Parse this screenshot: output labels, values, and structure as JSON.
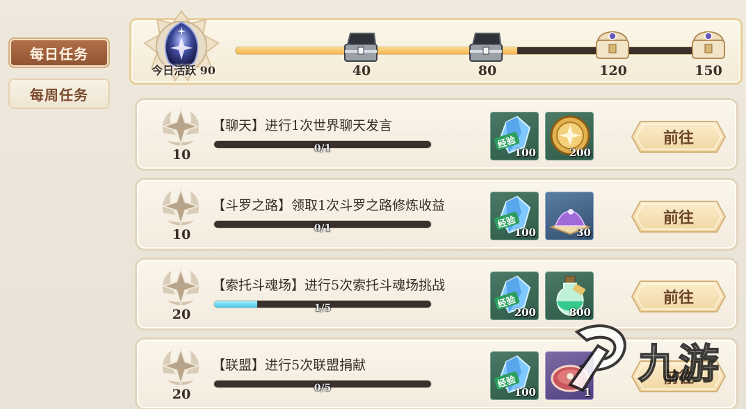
{
  "tabs": {
    "daily": "每日任务",
    "weekly": "每周任务"
  },
  "activity": {
    "label": "今日活跃 90",
    "progress_fraction": 0.58,
    "milestones": [
      "40",
      "80",
      "120",
      "150"
    ]
  },
  "tasks": [
    {
      "points": "10",
      "text": "【聊天】进行1次世界聊天发言",
      "progress_text": "0/1",
      "progress_fraction": 0,
      "rewards": [
        {
          "icon": "exp-crystal-icon",
          "count": "100"
        },
        {
          "icon": "gold-coin-icon",
          "count": "200"
        }
      ],
      "button": "前往"
    },
    {
      "points": "10",
      "text": "【斗罗之路】领取1次斗罗之路修炼收益",
      "progress_text": "0/1",
      "progress_fraction": 0,
      "rewards": [
        {
          "icon": "exp-crystal-icon",
          "count": "100"
        },
        {
          "icon": "purple-powder-icon",
          "count": "30"
        }
      ],
      "button": "前往"
    },
    {
      "points": "20",
      "text": "【索托斗魂场】进行5次索托斗魂场挑战",
      "progress_text": "1/5",
      "progress_fraction": 0.2,
      "rewards": [
        {
          "icon": "exp-crystal-icon",
          "count": "200"
        },
        {
          "icon": "potion-bottle-icon",
          "count": "800"
        }
      ],
      "button": "前往"
    },
    {
      "points": "20",
      "text": "【联盟】进行5次联盟捐献",
      "progress_text": "0/5",
      "progress_fraction": 0,
      "rewards": [
        {
          "icon": "exp-crystal-icon",
          "count": "100"
        },
        {
          "icon": "meat-icon",
          "count": "1"
        }
      ],
      "button": "前往"
    }
  ],
  "exp_badge": "经验",
  "watermark": "九游",
  "colors": {
    "accent": "#8f5332",
    "progress": "#f3b24f",
    "task_progress": "#4cc4e6"
  }
}
